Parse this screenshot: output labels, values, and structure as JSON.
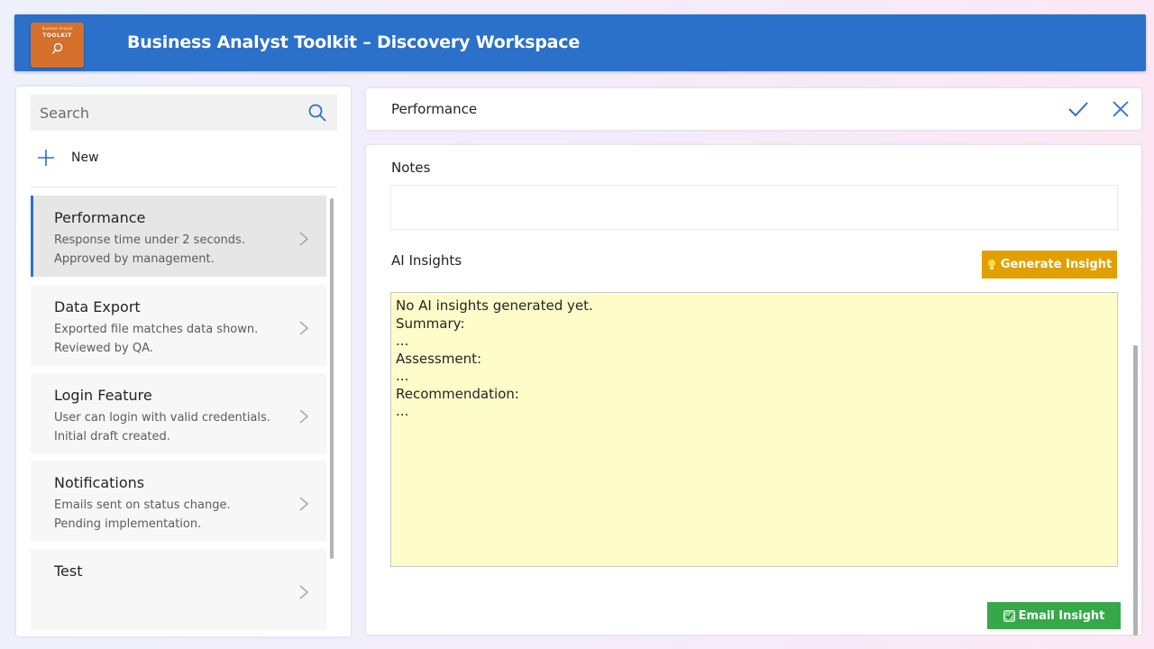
{
  "header": {
    "logo_small_text": "Business Analyst",
    "logo_text": "TOOLKIT",
    "title": "Business Analyst Toolkit – Discovery Workspace"
  },
  "sidebar": {
    "search_placeholder": "Search",
    "new_label": "New",
    "items": [
      {
        "title": "Performance",
        "line1": "Response time under 2 seconds.",
        "line2": "Approved by management.",
        "selected": true
      },
      {
        "title": "Data Export",
        "line1": "Exported file matches data shown.",
        "line2": "Reviewed by QA.",
        "selected": false
      },
      {
        "title": "Login Feature",
        "line1": "User can login with valid credentials.",
        "line2": "Initial draft created.",
        "selected": false
      },
      {
        "title": "Notifications",
        "line1": "Emails sent on status change.",
        "line2": "Pending implementation.",
        "selected": false
      },
      {
        "title": "Test",
        "line1": "",
        "line2": "",
        "selected": false
      }
    ]
  },
  "detail": {
    "record_title": "Performance",
    "notes_label": "Notes",
    "notes_value": "",
    "ai_label": "AI Insights",
    "generate_label": "Generate Insight",
    "insight_lines": [
      "No AI insights generated yet.",
      "",
      "Summary:",
      "",
      "...",
      "",
      "Assessment:",
      "",
      "...",
      "",
      "Recommendation:",
      "",
      "..."
    ],
    "email_label": "Email Insight"
  },
  "colors": {
    "header": "#2b70c9",
    "logo": "#d4702b",
    "generate_button": "#e2a000",
    "email_button": "#36a84a",
    "insight_background": "#fefdca",
    "selection_accent": "#2b70c9"
  }
}
